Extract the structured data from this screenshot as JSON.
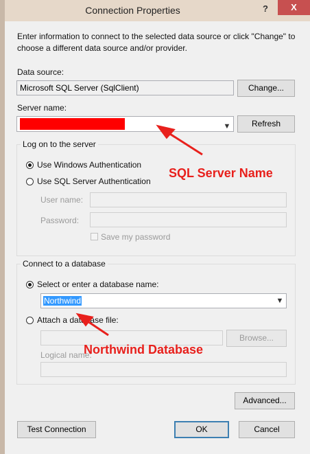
{
  "window": {
    "title": "Connection Properties",
    "help_glyph": "?",
    "close_glyph": "X"
  },
  "intro_text": "Enter information to connect to the selected data source or click \"Change\" to choose a different data source and/or provider.",
  "data_source": {
    "label": "Data source:",
    "value": "Microsoft SQL Server (SqlClient)",
    "change_button": "Change..."
  },
  "server": {
    "label": "Server name:",
    "refresh_button": "Refresh",
    "redaction_color": "#ff0000"
  },
  "logon": {
    "group_title": "Log on to the server",
    "windows_auth": "Use Windows Authentication",
    "sql_auth": "Use SQL Server Authentication",
    "user_name_label": "User name:",
    "password_label": "Password:",
    "save_password": "Save my password",
    "selected": "windows"
  },
  "database": {
    "group_title": "Connect to a database",
    "select_option": "Select or enter a database name:",
    "database_name": "Northwind",
    "attach_option": "Attach a database file:",
    "browse_button": "Browse...",
    "logical_name_label": "Logical name:",
    "selected": "select"
  },
  "buttons": {
    "advanced": "Advanced...",
    "test_connection": "Test Connection",
    "ok": "OK",
    "cancel": "Cancel"
  },
  "annotations": {
    "server_note": "SQL Server Name",
    "database_note": "Northwind Database",
    "color": "#e8201c"
  }
}
